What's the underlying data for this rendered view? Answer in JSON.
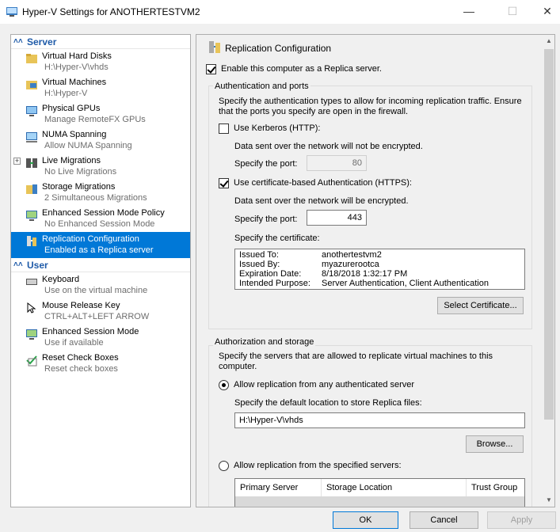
{
  "window": {
    "title": "Hyper-V Settings for ANOTHERTESTVM2"
  },
  "tree": {
    "server_header": "Server",
    "user_header": "User",
    "server_items": [
      {
        "label": "Virtual Hard Disks",
        "sub": "H:\\Hyper-V\\vhds",
        "icon": "folder-icon"
      },
      {
        "label": "Virtual Machines",
        "sub": "H:\\Hyper-V",
        "icon": "folder-vm-icon"
      },
      {
        "label": "Physical GPUs",
        "sub": "Manage RemoteFX GPUs",
        "icon": "monitor-icon"
      },
      {
        "label": "NUMA Spanning",
        "sub": "Allow NUMA Spanning",
        "icon": "numa-icon"
      },
      {
        "label": "Live Migrations",
        "sub": "No Live Migrations",
        "icon": "live-migration-icon"
      },
      {
        "label": "Storage Migrations",
        "sub": "2 Simultaneous Migrations",
        "icon": "storage-migration-icon"
      },
      {
        "label": "Enhanced Session Mode Policy",
        "sub": "No Enhanced Session Mode",
        "icon": "session-policy-icon"
      },
      {
        "label": "Replication Configuration",
        "sub": "Enabled as a Replica server",
        "icon": "replication-icon"
      }
    ],
    "user_items": [
      {
        "label": "Keyboard",
        "sub": "Use on the virtual machine",
        "icon": "keyboard-icon"
      },
      {
        "label": "Mouse Release Key",
        "sub": "CTRL+ALT+LEFT ARROW",
        "icon": "mouse-icon"
      },
      {
        "label": "Enhanced Session Mode",
        "sub": "Use if available",
        "icon": "session-icon"
      },
      {
        "label": "Reset Check Boxes",
        "sub": "Reset check boxes",
        "icon": "reset-icon"
      }
    ]
  },
  "panel": {
    "title": "Replication Configuration",
    "enable_replica_label": "Enable this computer as a Replica server.",
    "auth": {
      "group_label": "Authentication and ports",
      "description": "Specify the authentication types to allow for incoming replication traffic. Ensure that the ports you specify are open in the firewall.",
      "description_line1": "Specify the authentication types to allow for incoming replication traffic. Ensure",
      "description_line2": "that the ports you specify are open in the firewall.",
      "kerberos_label": "Use Kerberos (HTTP):",
      "kerberos_note": "Data sent over the network will not be encrypted.",
      "kerberos_port_label": "Specify the port:",
      "kerberos_port": "80",
      "cert_label": "Use certificate-based Authentication (HTTPS):",
      "cert_note": "Data sent over the network will be encrypted.",
      "cert_port_label": "Specify the port:",
      "cert_port": "443",
      "cert_specify_label": "Specify the certificate:",
      "cert_info": {
        "issued_to_label": "Issued To:",
        "issued_to": "anothertestvm2",
        "issued_by_label": "Issued By:",
        "issued_by": "myazurerootca",
        "expiration_label": "Expiration Date:",
        "expiration": "8/18/2018 1:32:17 PM",
        "purpose_label": "Intended Purpose:",
        "purpose": "Server Authentication, Client Authentication"
      },
      "select_cert_button": "Select Certificate..."
    },
    "storage": {
      "group_label": "Authorization and storage",
      "description_line1": "Specify the servers that are allowed to replicate virtual machines to this",
      "description_line2": "computer.",
      "allow_any_label": "Allow replication from any authenticated server",
      "default_location_label": "Specify the default location to store Replica files:",
      "default_location": "H:\\Hyper-V\\vhds",
      "browse_button": "Browse...",
      "allow_specified_label": "Allow replication from the specified servers:",
      "columns": [
        "Primary Server",
        "Storage Location",
        "Trust Group"
      ]
    }
  },
  "footer": {
    "ok": "OK",
    "cancel": "Cancel",
    "apply": "Apply"
  }
}
